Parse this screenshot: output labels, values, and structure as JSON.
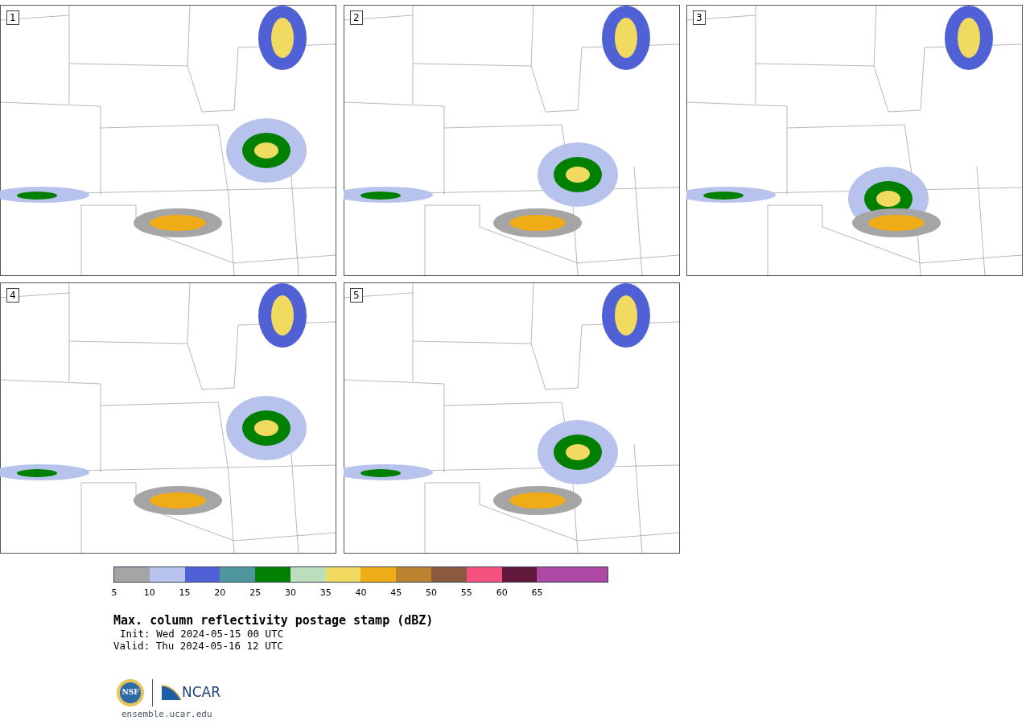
{
  "panels": [
    {
      "number": "1"
    },
    {
      "number": "2"
    },
    {
      "number": "3"
    },
    {
      "number": "4"
    },
    {
      "number": "5"
    }
  ],
  "colorbar": {
    "bins": [
      {
        "color": "#a5a5a5",
        "label": "5"
      },
      {
        "color": "#b7c3ed",
        "label": "10"
      },
      {
        "color": "#5060d5",
        "label": "15"
      },
      {
        "color": "#4f979c",
        "label": "20"
      },
      {
        "color": "#008000",
        "label": "25"
      },
      {
        "color": "#bddebc",
        "label": "30"
      },
      {
        "color": "#f0da5f",
        "label": "35"
      },
      {
        "color": "#f0ac17",
        "label": "40"
      },
      {
        "color": "#bb8330",
        "label": "45"
      },
      {
        "color": "#8a5a3e",
        "label": "50"
      },
      {
        "color": "#f55280",
        "label": "55"
      },
      {
        "color": "#61173a",
        "label": "60"
      },
      {
        "color": "#ae4aa6",
        "label": "65"
      },
      {
        "color": "#ae4aa6"
      }
    ]
  },
  "title": "Max. column reflectivity postage stamp (dBZ)",
  "init": "Init: Wed 2024-05-15 00 UTC",
  "valid": "Valid: Thu 2024-05-16 12 UTC",
  "logos": {
    "nsf": "NSF",
    "ncar": "NCAR"
  },
  "footer": "ensemble.ucar.edu"
}
